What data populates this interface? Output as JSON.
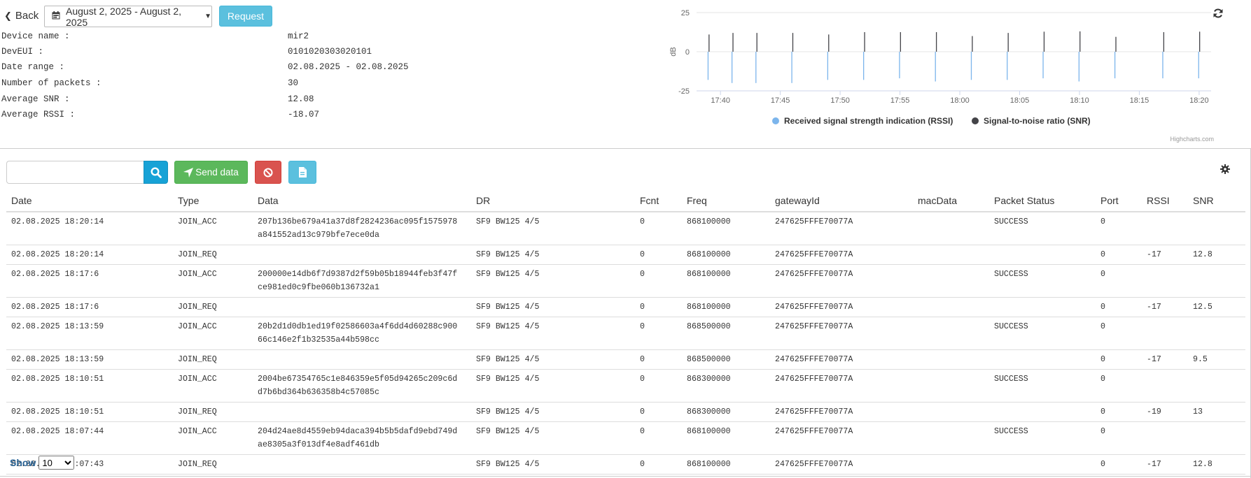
{
  "nav": {
    "back_label": "Back"
  },
  "filter": {
    "date_range": "August 2, 2025 - August 2, 2025",
    "request_label": "Request"
  },
  "device": {
    "fields": [
      {
        "label": "Device name :",
        "value": "mir2"
      },
      {
        "label": "DevEUI :",
        "value": "0101020303020101"
      },
      {
        "label": "Date range :",
        "value": "02.08.2025 - 02.08.2025"
      },
      {
        "label": "Number of packets :",
        "value": "30"
      },
      {
        "label": "Average SNR :",
        "value": "12.08"
      },
      {
        "label": "Average RSSI :",
        "value": "-18.07"
      }
    ]
  },
  "chart_data": {
    "type": "bar",
    "ylabel": "dB",
    "ylim": [
      -25,
      25
    ],
    "yticks": [
      25,
      0,
      -25
    ],
    "xticks": [
      "17:40",
      "17:45",
      "17:50",
      "17:55",
      "18:00",
      "18:05",
      "18:10",
      "18:15",
      "18:20"
    ],
    "xlim_minutes": [
      "17:38",
      "18:21"
    ],
    "grid": true,
    "legend": "bottom-center",
    "credit": "Highcharts.com",
    "series": [
      {
        "name": "Received signal strength indication (RSSI)",
        "color": "#7cb5ec",
        "x": [
          "17:39",
          "17:41",
          "17:43",
          "17:46",
          "17:49",
          "17:52",
          "17:55",
          "17:58",
          "18:01",
          "18:04",
          "18:07",
          "18:10",
          "18:13",
          "18:17",
          "18:20"
        ],
        "values": [
          -18,
          -20,
          -20,
          -20,
          -18,
          -18,
          -17,
          -19,
          -18,
          -18,
          -17,
          -19,
          -17,
          -17,
          -17
        ]
      },
      {
        "name": "Signal-to-noise ratio (SNR)",
        "color": "#434348",
        "x": [
          "17:39",
          "17:41",
          "17:43",
          "17:46",
          "17:49",
          "17:52",
          "17:55",
          "17:58",
          "18:01",
          "18:04",
          "18:07",
          "18:10",
          "18:13",
          "18:17",
          "18:20"
        ],
        "values": [
          11,
          12,
          12,
          12,
          11,
          12.5,
          12.5,
          12.5,
          10,
          12,
          12.8,
          13,
          9.5,
          12.5,
          12.8
        ]
      }
    ]
  },
  "toolbar": {
    "search_placeholder": "",
    "send_label": "Send data"
  },
  "table": {
    "columns": [
      "Date",
      "Type",
      "Data",
      "DR",
      "Fcnt",
      "Freq",
      "gatewayId",
      "macData",
      "Packet Status",
      "Port",
      "RSSI",
      "SNR"
    ],
    "rows": [
      {
        "date": "02.08.2025 18:20:14",
        "type": "JOIN_ACC",
        "data1": "207b136be679a41a37d8f2824236ac095f1575978",
        "data2": "a841552ad13c979bfe7ece0da",
        "dr": "SF9 BW125 4/5",
        "fcnt": "0",
        "freq": "868100000",
        "gw": "247625FFFE70077A",
        "mac": "",
        "status": "SUCCESS",
        "port": "0",
        "rssi": "",
        "snr": ""
      },
      {
        "date": "02.08.2025 18:20:14",
        "type": "JOIN_REQ",
        "data1": "",
        "data2": "",
        "dr": "SF9 BW125 4/5",
        "fcnt": "0",
        "freq": "868100000",
        "gw": "247625FFFE70077A",
        "mac": "",
        "status": "",
        "port": "0",
        "rssi": "-17",
        "snr": "12.8"
      },
      {
        "date": "02.08.2025 18:17:6",
        "type": "JOIN_ACC",
        "data1": "200000e14db6f7d9387d2f59b05b18944feb3f47f",
        "data2": "ce981ed0c9fbe060b136732a1",
        "dr": "SF9 BW125 4/5",
        "fcnt": "0",
        "freq": "868100000",
        "gw": "247625FFFE70077A",
        "mac": "",
        "status": "SUCCESS",
        "port": "0",
        "rssi": "",
        "snr": ""
      },
      {
        "date": "02.08.2025 18:17:6",
        "type": "JOIN_REQ",
        "data1": "",
        "data2": "",
        "dr": "SF9 BW125 4/5",
        "fcnt": "0",
        "freq": "868100000",
        "gw": "247625FFFE70077A",
        "mac": "",
        "status": "",
        "port": "0",
        "rssi": "-17",
        "snr": "12.5"
      },
      {
        "date": "02.08.2025 18:13:59",
        "type": "JOIN_ACC",
        "data1": "20b2d1d0db1ed19f02586603a4f6dd4d60288c900",
        "data2": "66c146e2f1b32535a44b598cc",
        "dr": "SF9 BW125 4/5",
        "fcnt": "0",
        "freq": "868500000",
        "gw": "247625FFFE70077A",
        "mac": "",
        "status": "SUCCESS",
        "port": "0",
        "rssi": "",
        "snr": ""
      },
      {
        "date": "02.08.2025 18:13:59",
        "type": "JOIN_REQ",
        "data1": "",
        "data2": "",
        "dr": "SF9 BW125 4/5",
        "fcnt": "0",
        "freq": "868500000",
        "gw": "247625FFFE70077A",
        "mac": "",
        "status": "",
        "port": "0",
        "rssi": "-17",
        "snr": "9.5"
      },
      {
        "date": "02.08.2025 18:10:51",
        "type": "JOIN_ACC",
        "data1": "2004be67354765c1e846359e5f05d94265c209c6d",
        "data2": "d7b6bd364b636358b4c57085c",
        "dr": "SF9 BW125 4/5",
        "fcnt": "0",
        "freq": "868300000",
        "gw": "247625FFFE70077A",
        "mac": "",
        "status": "SUCCESS",
        "port": "0",
        "rssi": "",
        "snr": ""
      },
      {
        "date": "02.08.2025 18:10:51",
        "type": "JOIN_REQ",
        "data1": "",
        "data2": "",
        "dr": "SF9 BW125 4/5",
        "fcnt": "0",
        "freq": "868300000",
        "gw": "247625FFFE70077A",
        "mac": "",
        "status": "",
        "port": "0",
        "rssi": "-19",
        "snr": "13"
      },
      {
        "date": "02.08.2025 18:07:44",
        "type": "JOIN_ACC",
        "data1": "204d24ae8d4559eb94daca394b5b5dafd9ebd749d",
        "data2": "ae8305a3f013df4e8adf461db",
        "dr": "SF9 BW125 4/5",
        "fcnt": "0",
        "freq": "868100000",
        "gw": "247625FFFE70077A",
        "mac": "",
        "status": "SUCCESS",
        "port": "0",
        "rssi": "",
        "snr": ""
      },
      {
        "date": "02.08.2025 18:07:43",
        "type": "JOIN_REQ",
        "data1": "",
        "data2": "",
        "dr": "SF9 BW125 4/5",
        "fcnt": "0",
        "freq": "868100000",
        "gw": "247625FFFE70077A",
        "mac": "",
        "status": "",
        "port": "0",
        "rssi": "-17",
        "snr": "12.8"
      }
    ]
  },
  "pagination": {
    "show_label": "Show",
    "page_size": "10"
  }
}
